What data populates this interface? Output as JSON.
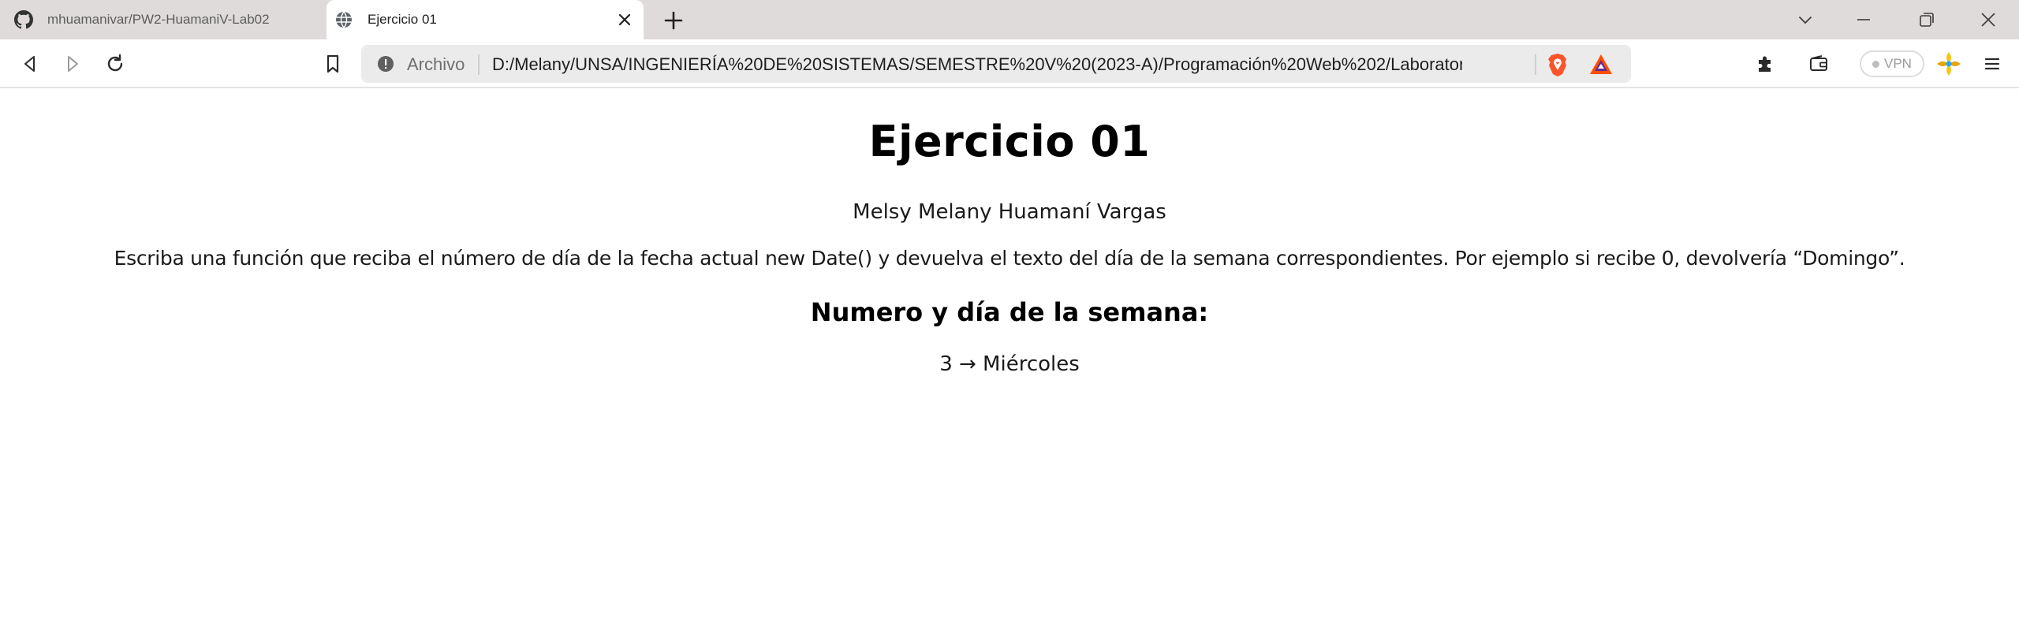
{
  "browser": {
    "tabs": [
      {
        "title": "mhuamanivar/PW2-HuamaniV-Lab02",
        "favicon": "github-icon",
        "active": false
      },
      {
        "title": "Ejercicio 01",
        "favicon": "globe-icon",
        "active": true
      }
    ],
    "address_bar": {
      "security_chip": "Archivo",
      "url": "D:/Melany/UNSA/INGENIERÍA%20DE%20SISTEMAS/SEMESTRE%20V%20(2023-A)/Programación%20Web%202/Laboratorio..."
    },
    "vpn_label": "VPN",
    "colors": {
      "tabstrip_bg": "#e0dbdb",
      "omnibox_bg": "#ebebeb",
      "brave_orange": "#fb542b",
      "bat_purple": "#662d91",
      "bat_red": "#ff5000"
    }
  },
  "page": {
    "heading": "Ejercicio 01",
    "author": "Melsy Melany Huamaní Vargas",
    "statement": "Escriba una función que reciba el número de día de la fecha actual new Date() y devuelva el texto del día de la semana correspondientes. Por ejemplo si recibe 0, devolvería “Domingo”.",
    "subheading": "Numero y día de la semana:",
    "result": "3 → Miércoles"
  }
}
